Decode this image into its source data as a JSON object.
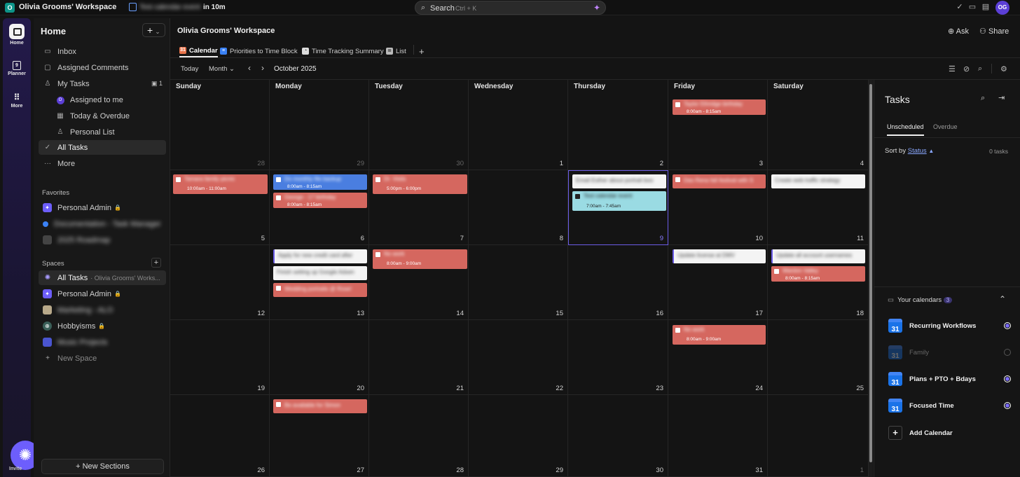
{
  "topbar": {
    "workspace_badge": "O",
    "workspace_name": "Olivia Grooms' Workspace",
    "next_event_label": "Test calendar event",
    "next_event_when": "in 10m",
    "search_placeholder": "Search",
    "search_shortcut": "Ctrl + K",
    "avatar_initials": "OG"
  },
  "rail": {
    "home_label": "Home",
    "planner_label": "Planner",
    "planner_day": "9",
    "more_label": "More",
    "invite_label": "Invite"
  },
  "sidebar": {
    "title": "Home",
    "items": {
      "inbox": "Inbox",
      "assigned_comments": "Assigned Comments",
      "my_tasks": "My Tasks",
      "my_tasks_count": "1",
      "assigned_to_me": "Assigned to me",
      "today_overdue": "Today & Overdue",
      "personal_list": "Personal List",
      "all_tasks": "All Tasks",
      "more": "More"
    },
    "favorites_heading": "Favorites",
    "favorites": [
      "Personal Admin",
      "Documentation - Task Manager",
      "2025 Roadmap"
    ],
    "spaces_heading": "Spaces",
    "spaces": {
      "all_tasks": "All Tasks",
      "all_tasks_note": "· Olivia Grooms' Works...",
      "personal_admin": "Personal Admin",
      "marketing": "Marketing - ALO",
      "hobbyisms": "Hobbyisms",
      "music_projects": "Music Projects",
      "new_space": "New Space"
    },
    "new_sections": "New Sections"
  },
  "main": {
    "title": "Olivia Grooms' Workspace",
    "ask_label": "Ask",
    "share_label": "Share",
    "tabs": [
      "Calendar",
      "Priorities to Time Block",
      "Time Tracking Summary",
      "List"
    ],
    "today_btn": "Today",
    "view_mode": "Month",
    "month_label": "October 2025"
  },
  "calendar": {
    "weekdays": [
      "Sunday",
      "Monday",
      "Tuesday",
      "Wednesday",
      "Thursday",
      "Friday",
      "Saturday"
    ],
    "weeks": [
      [
        "28",
        "29",
        "30",
        "1",
        "2",
        "3",
        "4"
      ],
      [
        "5",
        "6",
        "7",
        "8",
        "9",
        "10",
        "11"
      ],
      [
        "12",
        "13",
        "14",
        "15",
        "16",
        "17",
        "18"
      ],
      [
        "19",
        "20",
        "21",
        "22",
        "23",
        "24",
        "25"
      ],
      [
        "26",
        "27",
        "28",
        "29",
        "30",
        "31",
        "1"
      ]
    ],
    "events": {
      "fri3": {
        "title": "Taylor Ethridge birthday",
        "time": "8:00am - 8:15am"
      },
      "sun5": {
        "title": "Tamara family picnic",
        "time": "10:00am - 11:00am"
      },
      "mon6a": {
        "title": "Do monthly file backup",
        "time": "8:00am - 8:15am"
      },
      "mon6b": {
        "title": "George - 17 birthday",
        "time": "8:00am - 8:15am"
      },
      "tue7": {
        "title": "Dr. Visits",
        "time": "5:00pm - 6:00pm"
      },
      "thu9a": {
        "title": "Email Esther about portrait boo"
      },
      "thu9b": {
        "title": "Test calendar event",
        "time": "7:00am - 7:45am"
      },
      "fri10": {
        "title": "Das Rena fall festival with S"
      },
      "sat11": {
        "title": "Create web traffic strategy"
      },
      "mon13a": {
        "title": "Apply for new credit card after"
      },
      "mon13b": {
        "title": "Finish setting up Google Adsen"
      },
      "mon13c": {
        "title": "Wedding portraits @ Rose!"
      },
      "tue14": {
        "title": "No work",
        "time": "8:00am - 9:00am"
      },
      "fri17": {
        "title": "Update license at DMV"
      },
      "sat18a": {
        "title": "Update all account usernames"
      },
      "sat18b": {
        "title": "Wardon Valley",
        "time": "8:00am - 8:15am"
      },
      "fri24": {
        "title": "No work",
        "time": "8:00am - 9:00am"
      },
      "mon27": {
        "title": "Be available for Simon"
      }
    }
  },
  "panel": {
    "title": "Tasks",
    "tab_unscheduled": "Unscheduled",
    "tab_overdue": "Overdue",
    "sort_prefix": "Sort by",
    "sort_field": "Status",
    "count": "0 tasks",
    "calendars_heading": "Your calendars",
    "calendars_count": "3",
    "calendars": [
      "Recurring Workflows",
      "Family",
      "Plans + PTO + Bdays",
      "Focused Time"
    ],
    "calendar_icon_num": "31",
    "add_calendar": "Add Calendar"
  },
  "colors": {
    "accent": "#6b5ce7",
    "event_red": "#d5675f",
    "event_blue": "#4a7ee0",
    "event_cyan": "#9adbe3"
  }
}
